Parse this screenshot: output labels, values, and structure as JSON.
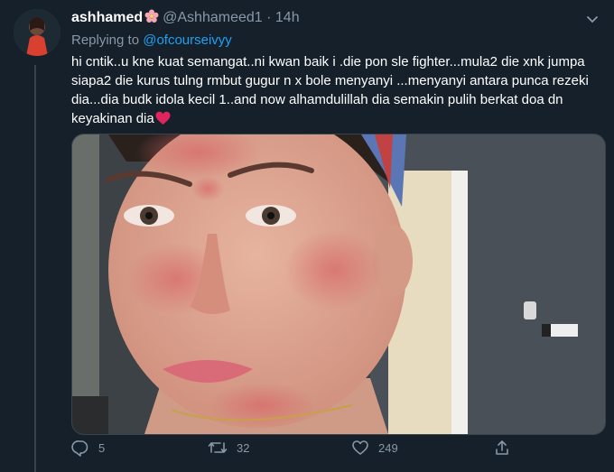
{
  "tweet": {
    "display_name": "ashhamed",
    "handle": "@Ashhameed1",
    "separator": "·",
    "time": "14h",
    "reply_prefix": "Replying to",
    "reply_to": "@ofcourseivyy",
    "text": "hi cntik..u kne kuat semangat..ni kwan baik i .die pon sle fighter...mula2 die xnk jumpa siapa2 die kurus tulng rmbut gugur n x bole menyanyi ...menyanyi antara punca rezeki dia...dia budk idola kecil 1..and now alhamdulillah dia semakin pulih berkat doa dn keyakinan dia"
  },
  "actions": {
    "replies": "5",
    "retweets": "32",
    "likes": "249"
  },
  "icons": [
    "flower-emoji-icon",
    "chevron-down-icon",
    "heart-emoji-icon",
    "reply-icon",
    "retweet-icon",
    "like-icon",
    "share-icon"
  ],
  "colors": {
    "background": "#15202b",
    "link": "#1da1f2",
    "muted": "#8899a6",
    "heart": "#e0245e"
  }
}
